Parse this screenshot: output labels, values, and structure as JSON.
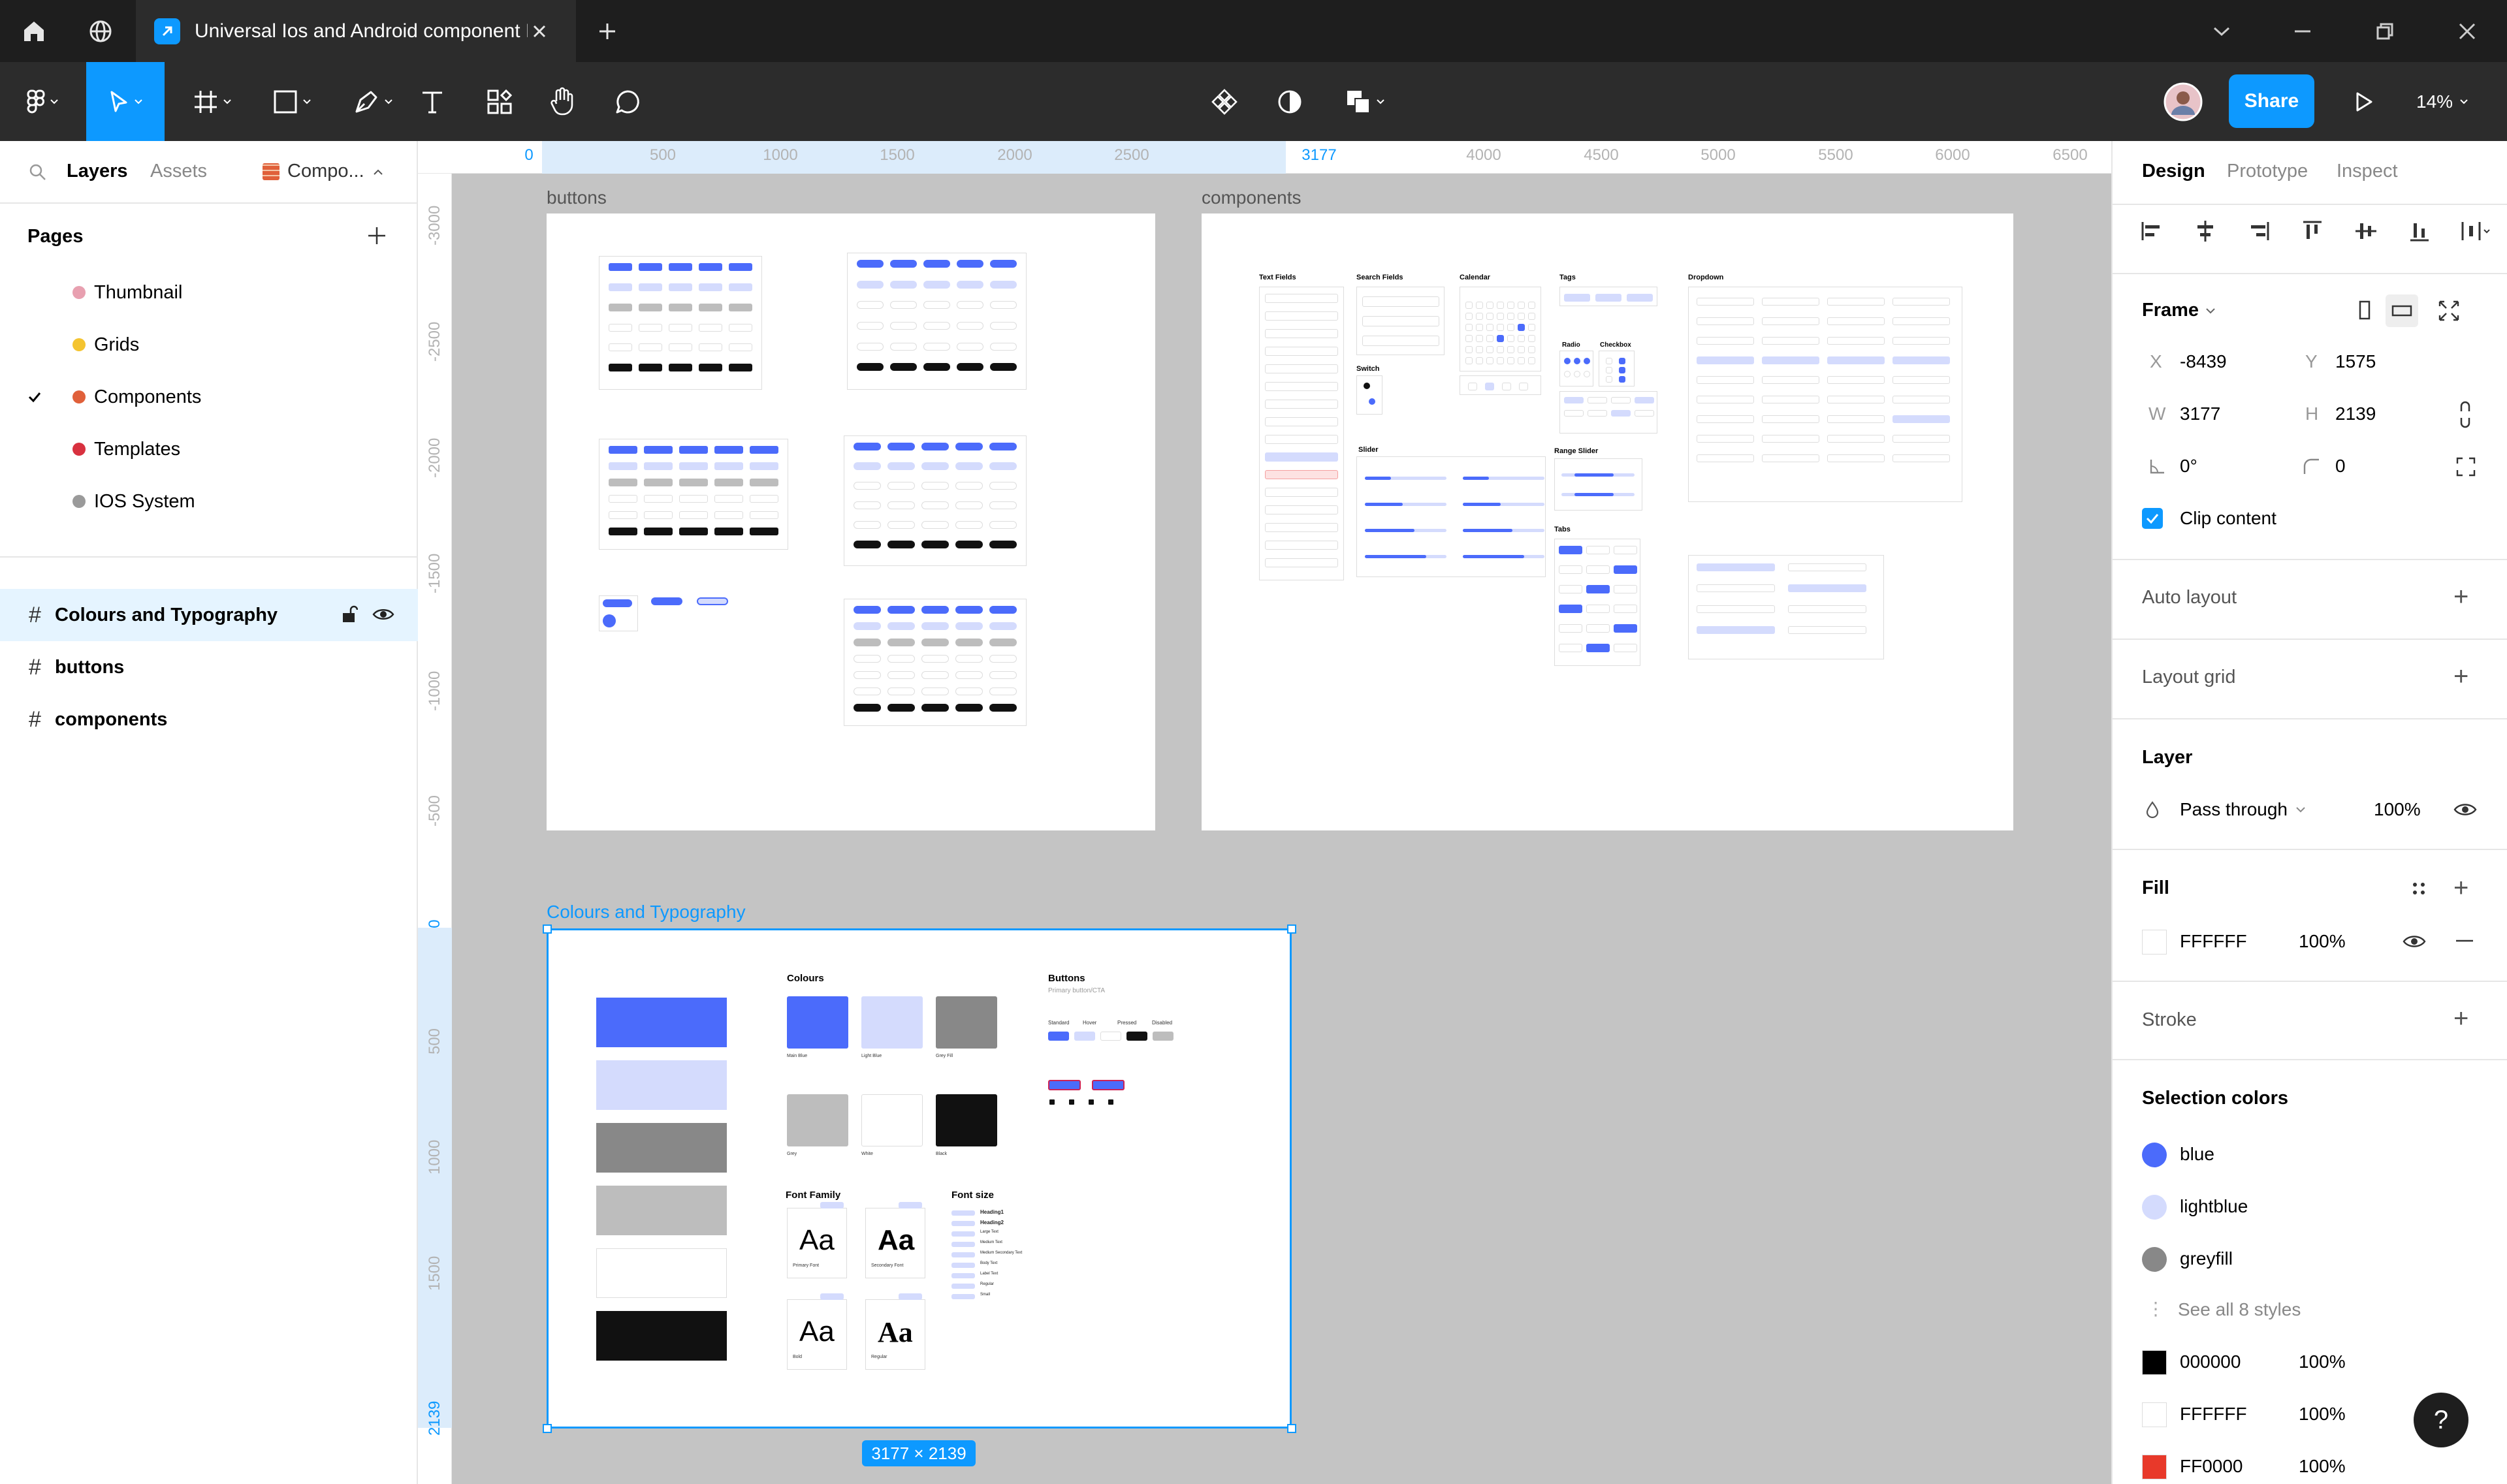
{
  "window": {
    "file_tab_title": "Universal Ios and Android component L"
  },
  "toolbar": {
    "share_label": "Share",
    "zoom": "14%"
  },
  "left_panel": {
    "tabs": {
      "layers": "Layers",
      "assets": "Assets",
      "file": "Compo..."
    },
    "pages_title": "Pages",
    "pages": [
      {
        "label": "Thumbnail",
        "icon": "brain-emoji-icon",
        "checked": false
      },
      {
        "label": "Grids",
        "icon": "sun-emoji-icon",
        "checked": false
      },
      {
        "label": "Components",
        "icon": "bricks-emoji-icon",
        "checked": true
      },
      {
        "label": "Templates",
        "icon": "lipstick-emoji-icon",
        "checked": false
      },
      {
        "label": "IOS System",
        "icon": "gear-emoji-icon",
        "checked": false
      }
    ],
    "layers": [
      {
        "label": "Colours and Typography",
        "selected": true
      },
      {
        "label": "buttons",
        "selected": false
      },
      {
        "label": "components",
        "selected": false
      }
    ]
  },
  "rulers": {
    "top": [
      "0",
      "500",
      "1000",
      "1500",
      "2000",
      "2500",
      "3177",
      "4000",
      "4500",
      "5000",
      "5500",
      "6000",
      "6500"
    ],
    "left": [
      "-3000",
      "-2500",
      "-2000",
      "-1500",
      "-1000",
      "-500",
      "0",
      "500",
      "1000",
      "1500",
      "2139"
    ]
  },
  "canvas": {
    "frames": {
      "buttons": "buttons",
      "components": "components",
      "colours": "Colours and Typography"
    },
    "selection_size": "3177 × 2139",
    "components_labels": {
      "text_fields": "Text Fields",
      "search_fields": "Search Fields",
      "calendar": "Calendar",
      "tags": "Tags",
      "dropdown": "Dropdown",
      "switch": "Switch",
      "radio": "Radio",
      "checkbox": "Checkbox",
      "slider": "Slider",
      "range_slider": "Range Slider",
      "tabs": "Tabs"
    },
    "colours_frame": {
      "colours_title": "Colours",
      "buttons_title": "Buttons",
      "buttons_sub": "Primary button/CTA",
      "states": [
        "Standard",
        "Hover",
        "Pressed",
        "Disabled"
      ],
      "font_family": "Font Family",
      "font_size": "Font size",
      "aa": "Aa",
      "swatch_names": [
        "Main Blue",
        "Light Blue",
        "Grey Fill",
        "Grey",
        "White",
        "Black"
      ],
      "font_labels": [
        "Primary Font",
        "Secondary Font",
        "Bold",
        "Regular"
      ],
      "font_sizes": [
        "Heading1",
        "Heading2",
        "Large Text",
        "Medium Text",
        "Medium Secondary Text",
        "Body Text",
        "Label Text",
        "Regular",
        "Small"
      ]
    }
  },
  "right_panel": {
    "tabs": {
      "design": "Design",
      "prototype": "Prototype",
      "inspect": "Inspect"
    },
    "frame_label": "Frame",
    "x_label": "X",
    "x": "-8439",
    "y_label": "Y",
    "y": "1575",
    "w_label": "W",
    "w": "3177",
    "h_label": "H",
    "h": "2139",
    "rotation": "0°",
    "radius": "0",
    "clip_content": "Clip content",
    "auto_layout": "Auto layout",
    "layout_grid": "Layout grid",
    "layer_title": "Layer",
    "blend_mode": "Pass through",
    "layer_opacity": "100%",
    "fill_title": "Fill",
    "fill_hex": "FFFFFF",
    "fill_opacity": "100%",
    "stroke_title": "Stroke",
    "selection_colors_title": "Selection colors",
    "selection_styles": [
      {
        "name": "blue",
        "color": "#4b6bfb"
      },
      {
        "name": "lightblue",
        "color": "#d4dbfd"
      },
      {
        "name": "greyfill",
        "color": "#888888"
      }
    ],
    "see_all": "See all 8 styles",
    "selection_colors": [
      {
        "hex": "000000",
        "opacity": "100%",
        "color": "#000000"
      },
      {
        "hex": "FFFFFF",
        "opacity": "100%",
        "color": "#ffffff"
      },
      {
        "hex": "FF0000",
        "opacity": "100%",
        "color": "#e8392a"
      }
    ],
    "help": "?"
  }
}
